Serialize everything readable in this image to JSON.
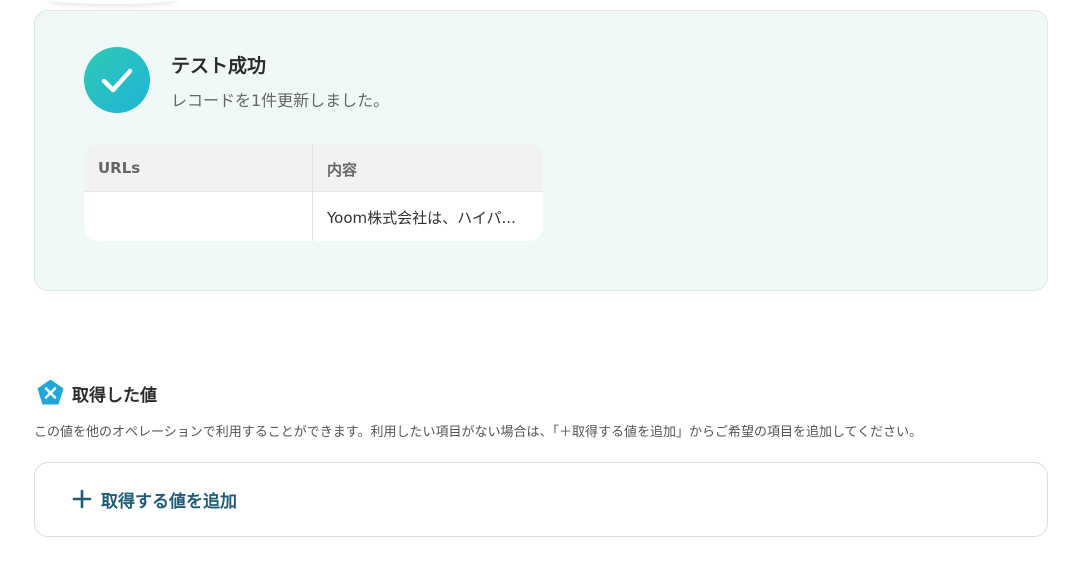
{
  "test_result": {
    "title": "テスト成功",
    "message": "レコードを1件更新しました。",
    "status_color": "#22c0c8"
  },
  "record_table": {
    "columns": [
      "URLs",
      "内容"
    ],
    "rows": [
      [
        "",
        "Yoom株式会社は、ハイパ..."
      ]
    ]
  },
  "acquired_values": {
    "title": "取得した値",
    "description": "この値を他のオペレーションで利用することができます。利用したい項目がない場合は、「＋取得する値を追加」からご希望の項目を追加してください。",
    "add_button_label": "取得する値を追加",
    "icon": "pentagon-x-icon",
    "accent_color": "#1d5c77"
  }
}
